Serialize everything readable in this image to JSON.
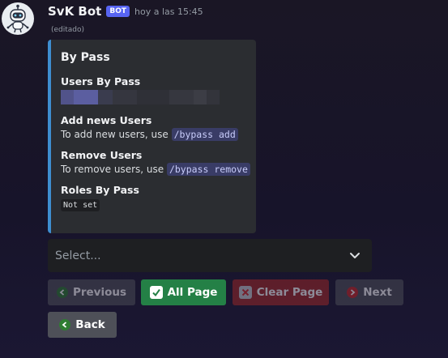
{
  "message": {
    "username": "SvK Bot",
    "badge": "BOT",
    "timestamp": "hoy a las 15:45",
    "edited": "(editado)"
  },
  "embed": {
    "accent_color": "#3e8ed0",
    "title": "By Pass",
    "fields": [
      {
        "name": "Users By Pass"
      },
      {
        "name": "Add news Users",
        "text": "To add new users, use",
        "code": "/bypass add"
      },
      {
        "name": "Remove Users",
        "text": "To remove users, use",
        "code": "/bypass remove"
      },
      {
        "name": "Roles By Pass",
        "code": "Not set"
      }
    ]
  },
  "select": {
    "placeholder": "Select..."
  },
  "buttons": {
    "previous": "Previous",
    "all_page": "All Page",
    "clear_page": "Clear Page",
    "next": "Next",
    "back": "Back"
  },
  "colors": {
    "blurple": "#5865f2",
    "success": "#248046",
    "danger": "#a12828",
    "secondary": "#4e5058"
  }
}
